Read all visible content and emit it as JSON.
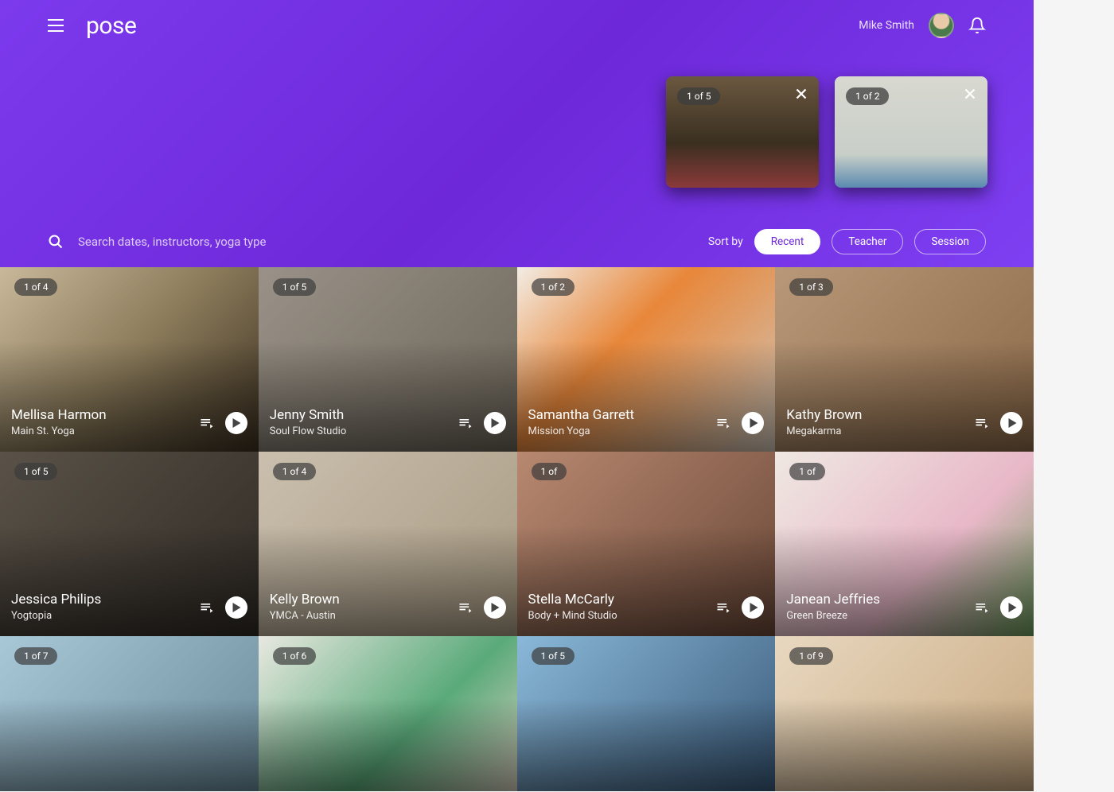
{
  "header": {
    "logo": "pose",
    "user_name": "Mike Smith"
  },
  "search": {
    "placeholder": "Search dates, instructors, yoga type"
  },
  "sort": {
    "label": "Sort by",
    "options": [
      "Recent",
      "Teacher",
      "Session"
    ],
    "active": "Recent"
  },
  "mini_cards": [
    {
      "badge": "1 of 5"
    },
    {
      "badge": "1 of 2"
    }
  ],
  "cards": [
    {
      "badge": "1 of 4",
      "title": "Mellisa Harmon",
      "subtitle": "Main St. Yoga"
    },
    {
      "badge": "1 of 5",
      "title": "Jenny Smith",
      "subtitle": "Soul Flow Studio"
    },
    {
      "badge": "1 of 2",
      "title": "Samantha Garrett",
      "subtitle": "Mission Yoga"
    },
    {
      "badge": "1 of 3",
      "title": "Kathy Brown",
      "subtitle": "Megakarma"
    },
    {
      "badge": "1 of 5",
      "title": "Jessica Philips",
      "subtitle": "Yogtopia"
    },
    {
      "badge": "1 of 4",
      "title": "Kelly Brown",
      "subtitle": "YMCA - Austin"
    },
    {
      "badge": "1 of",
      "title": "Stella McCarly",
      "subtitle": "Body + Mind Studio"
    },
    {
      "badge": "1 of",
      "title": "Janean Jeffries",
      "subtitle": "Green Breeze"
    },
    {
      "badge": "1 of 7",
      "title": "",
      "subtitle": ""
    },
    {
      "badge": "1 of 6",
      "title": "",
      "subtitle": ""
    },
    {
      "badge": "1 of 5",
      "title": "",
      "subtitle": ""
    },
    {
      "badge": "1 of 9",
      "title": "",
      "subtitle": ""
    }
  ]
}
